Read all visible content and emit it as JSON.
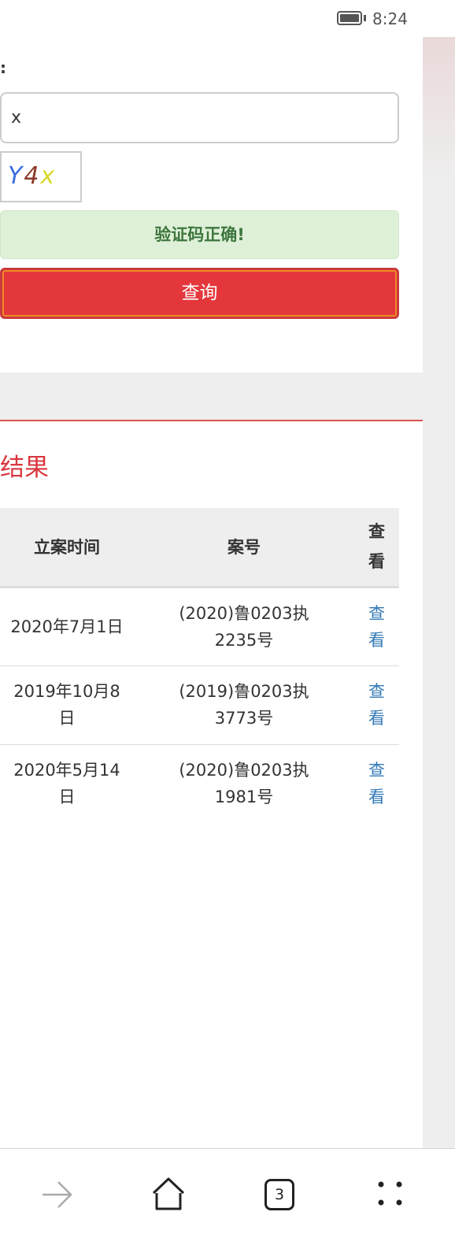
{
  "status_bar": {
    "time": "8:24",
    "battery_icon": "battery-icon"
  },
  "form": {
    "label_fragment": ":",
    "captcha_value": "x",
    "captcha_image_text": "Y4x",
    "alert": "验证码正确!",
    "query_button": "查询"
  },
  "colors": {
    "accent": "#e4373c",
    "success_bg": "#dff0d8",
    "success_text": "#3c763d",
    "link": "#337ab7"
  },
  "results": {
    "title": "结果",
    "headers": [
      "立案时间",
      "案号",
      "查看"
    ],
    "rows": [
      {
        "date": "2020年7月1日",
        "case": "(2020)鲁0203执2235号",
        "view": "查看"
      },
      {
        "date": "2019年10月8日",
        "case": "(2019)鲁0203执3773号",
        "view": "查看"
      },
      {
        "date": "2020年5月14日",
        "case": "(2020)鲁0203执1981号",
        "view": "查看"
      }
    ]
  },
  "bottom_nav": {
    "tabs_count": "3",
    "icons": [
      "forward-icon",
      "home-icon",
      "tabs-icon",
      "menu-icon"
    ]
  }
}
